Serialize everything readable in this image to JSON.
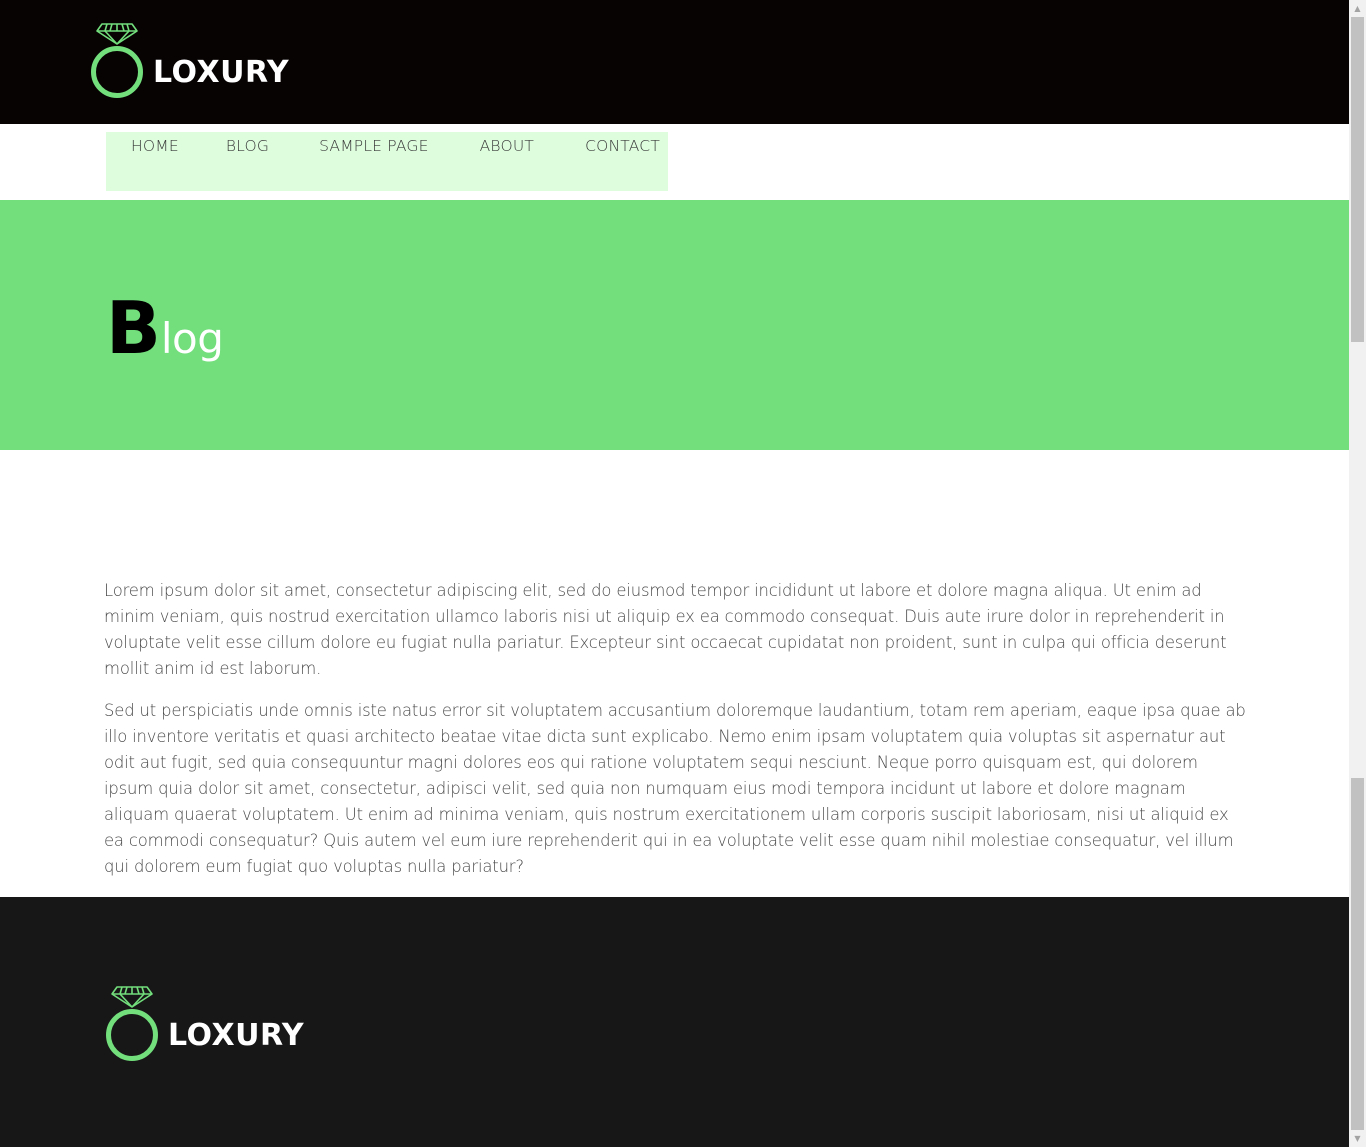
{
  "brand": {
    "name": "LOXURY",
    "accent_color": "#72de7c",
    "header_bg": "#070303",
    "footer_bg": "#171717"
  },
  "nav": {
    "items": [
      {
        "label": "HOME"
      },
      {
        "label": "BLOG"
      },
      {
        "label": "SAMPLE PAGE"
      },
      {
        "label": "ABOUT"
      },
      {
        "label": "CONTACT"
      }
    ]
  },
  "hero": {
    "title_first_letter": "B",
    "title_rest": "log"
  },
  "content": {
    "paragraphs": [
      "Lorem ipsum dolor sit amet, consectetur adipiscing elit, sed do eiusmod tempor incididunt ut labore et dolore magna aliqua. Ut enim ad minim veniam, quis nostrud exercitation ullamco laboris nisi ut aliquip ex ea commodo consequat. Duis aute irure dolor in reprehenderit in voluptate velit esse cillum dolore eu fugiat nulla pariatur. Excepteur sint occaecat cupidatat non proident, sunt in culpa qui officia deserunt mollit anim id est laborum.",
      "Sed ut perspiciatis unde omnis iste natus error sit voluptatem accusantium doloremque laudantium, totam rem aperiam, eaque ipsa quae ab illo inventore veritatis et quasi architecto beatae vitae dicta sunt explicabo. Nemo enim ipsam voluptatem quia voluptas sit aspernatur aut odit aut fugit, sed quia consequuntur magni dolores eos qui ratione voluptatem sequi nesciunt. Neque porro quisquam est, qui dolorem ipsum quia dolor sit amet, consectetur, adipisci velit, sed quia non numquam eius modi tempora incidunt ut labore et dolore magnam aliquam quaerat voluptatem. Ut enim ad minima veniam, quis nostrum exercitationem ullam corporis suscipit laboriosam, nisi ut aliquid ex ea commodi consequatur? Quis autem vel eum iure reprehenderit qui in ea voluptate velit esse quam nihil molestiae consequatur, vel illum qui dolorem eum fugiat quo voluptas nulla pariatur?"
    ]
  },
  "icons": {
    "logo": "diamond-ring-icon",
    "scroll_up": "arrow-up-icon",
    "scroll_down": "arrow-down-icon"
  }
}
